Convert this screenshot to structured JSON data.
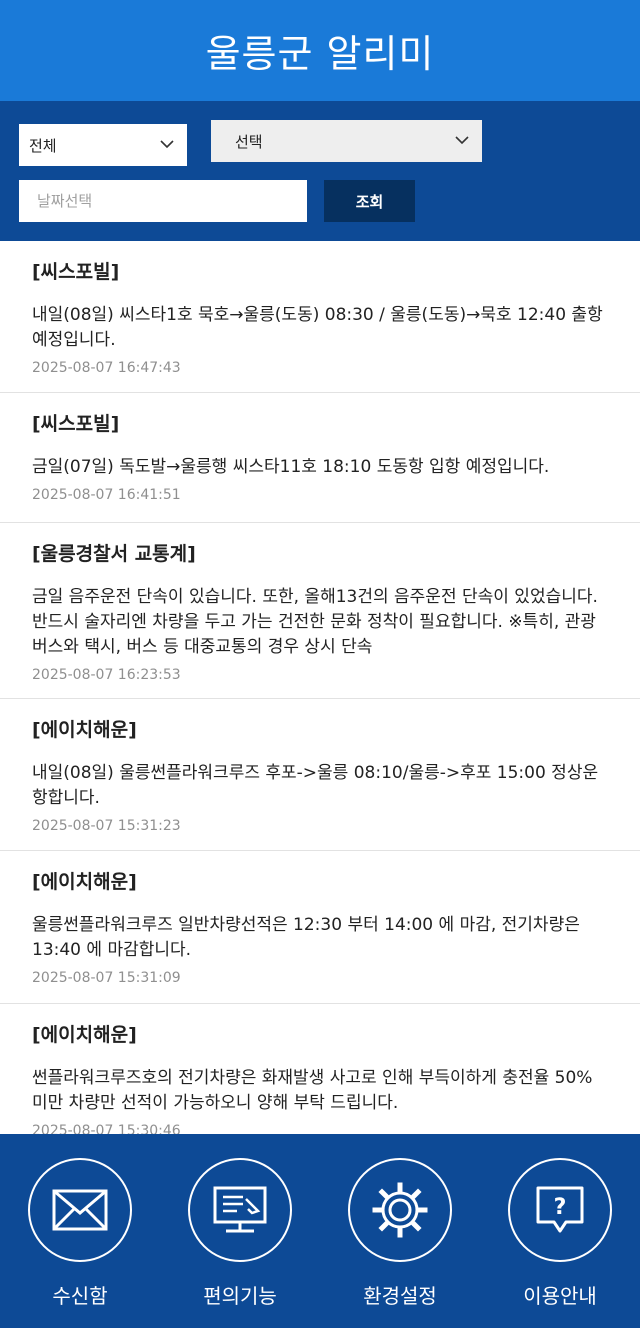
{
  "header": {
    "title": "울릉군 알리미"
  },
  "filter": {
    "category_select": "전체",
    "type_select": "선택",
    "date_placeholder": "날짜선택",
    "search_label": "조회"
  },
  "messages": [
    {
      "title": "[씨스포빌]",
      "body": "내일(08일) 씨스타1호 묵호→울릉(도동) 08:30 / 울릉(도동)→묵호 12:40 출항 예정입니다.",
      "date": "2025-08-07 16:47:43"
    },
    {
      "title": "[씨스포빌]",
      "body": "금일(07일) 독도발→울릉행 씨스타11호 18:10 도동항 입항 예정입니다.",
      "date": "2025-08-07 16:41:51"
    },
    {
      "title": "[울릉경찰서 교통계]",
      "body": "금일 음주운전 단속이 있습니다. 또한, 올해13건의 음주운전 단속이 있었습니다. 반드시 술자리엔 차량을 두고 가는 건전한 문화 정착이 필요합니다. ※특히, 관광버스와 택시, 버스 등 대중교통의 경우 상시 단속",
      "date": "2025-08-07 16:23:53"
    },
    {
      "title": "[에이치해운]",
      "body": "내일(08일) 울릉썬플라워크루즈 후포->울릉 08:10/울릉->후포 15:00 정상운항합니다.",
      "date": "2025-08-07 15:31:23"
    },
    {
      "title": "[에이치해운]",
      "body": "울릉썬플라워크루즈 일반차량선적은 12:30 부터 14:00 에 마감, 전기차량은 13:40 에 마감합니다.",
      "date": "2025-08-07 15:31:09"
    },
    {
      "title": "[에이치해운]",
      "body": "썬플라워크루즈호의 전기차량은 화재발생 사고로 인해 부득이하게 충전율 50% 미만 차량만 선적이 가능하오니 양해 부탁 드립니다.",
      "date": "2025-08-07 15:30:46"
    }
  ],
  "bottom_nav": [
    {
      "label": "수신함",
      "icon": "envelope-icon"
    },
    {
      "label": "편의기능",
      "icon": "monitor-icon"
    },
    {
      "label": "환경설정",
      "icon": "gear-icon"
    },
    {
      "label": "이용안내",
      "icon": "help-icon"
    }
  ],
  "colors": {
    "header": "#1a7ad8",
    "panel": "#0d4a96",
    "button": "#06305f"
  }
}
